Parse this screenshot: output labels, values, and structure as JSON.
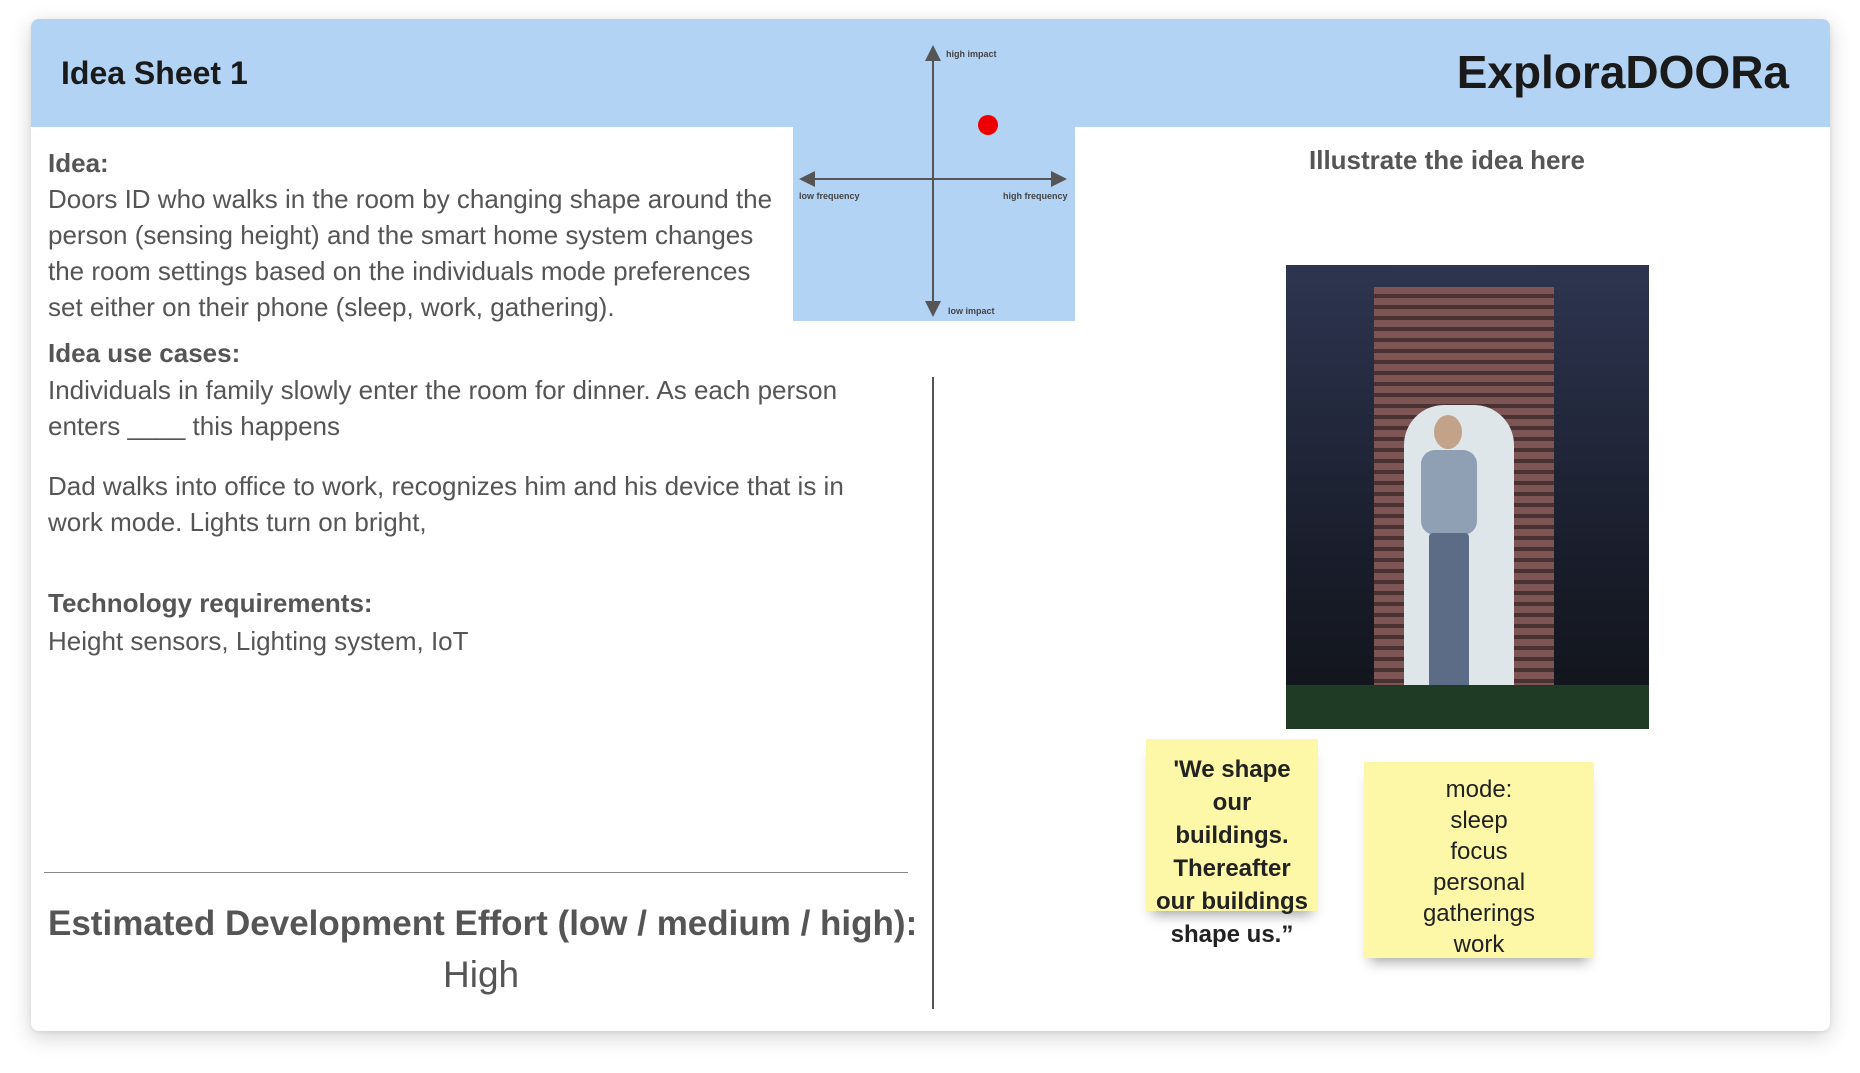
{
  "header": {
    "sheet_title": "Idea Sheet 1",
    "app_title": "ExploraDOORa"
  },
  "matrix": {
    "top_label": "high impact",
    "bottom_label": "low impact",
    "left_label": "low frequency",
    "right_label": "high frequency",
    "marker_color": "#ee0000",
    "marker": {
      "frequency": 0.72,
      "impact": 0.72
    }
  },
  "idea": {
    "label": "Idea:",
    "lines": [
      "Doors ID who walks in the room by changing shape around the",
      "person (sensing height) and the smart home system changes",
      "the room settings based on the individuals mode preferences",
      "set either on their phone (sleep, work, gathering)."
    ]
  },
  "use_cases": {
    "label": "Idea use cases:",
    "case1_lines": [
      "Individuals in family slowly enter the room for dinner. As each person",
      "enters ____ this happens"
    ],
    "case2_lines": [
      "Dad walks into office to work, recognizes him and his device that is in",
      "work mode. Lights turn on bright,"
    ]
  },
  "technology": {
    "label": "Technology requirements:",
    "value": "Height sensors, Lighting system, IoT"
  },
  "effort": {
    "label": "Estimated Development Effort (low / medium / high):",
    "value": "High"
  },
  "illustration": {
    "title": "Illustrate the idea here"
  },
  "stickies": {
    "quote_lines": [
      "'We shape",
      "our buildings.",
      "Thereafter",
      "our buildings",
      "shape us.”"
    ],
    "mode_lines": [
      "mode:",
      "sleep",
      "focus",
      "personal",
      "gatherings",
      "work"
    ]
  },
  "colors": {
    "header_bg": "#b3d3f5",
    "sticky_bg": "#fdf8a8"
  }
}
